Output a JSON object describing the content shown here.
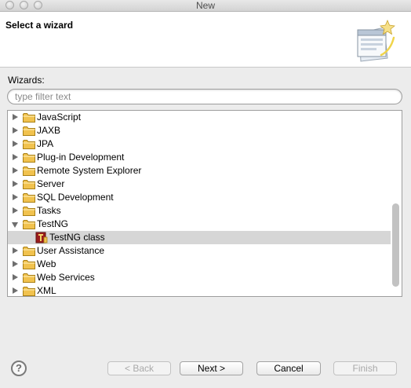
{
  "window": {
    "title": "New"
  },
  "banner": {
    "title": "Select a wizard"
  },
  "wizards_label": "Wizards:",
  "filter": {
    "placeholder": "type filter text",
    "value": ""
  },
  "tree": {
    "items": [
      {
        "label": "JavaScript",
        "type": "folder",
        "expanded": false
      },
      {
        "label": "JAXB",
        "type": "folder",
        "expanded": false
      },
      {
        "label": "JPA",
        "type": "folder",
        "expanded": false
      },
      {
        "label": "Plug-in Development",
        "type": "folder",
        "expanded": false
      },
      {
        "label": "Remote System Explorer",
        "type": "folder",
        "expanded": false
      },
      {
        "label": "Server",
        "type": "folder",
        "expanded": false
      },
      {
        "label": "SQL Development",
        "type": "folder",
        "expanded": false
      },
      {
        "label": "Tasks",
        "type": "folder",
        "expanded": false
      },
      {
        "label": "TestNG",
        "type": "folder",
        "expanded": true
      },
      {
        "label": "TestNG class",
        "type": "item",
        "selected": true
      },
      {
        "label": "User Assistance",
        "type": "folder",
        "expanded": false
      },
      {
        "label": "Web",
        "type": "folder",
        "expanded": false
      },
      {
        "label": "Web Services",
        "type": "folder",
        "expanded": false
      },
      {
        "label": "XML",
        "type": "folder",
        "expanded": false
      }
    ],
    "scroll_position": 0.62
  },
  "buttons": {
    "back": "< Back",
    "next": "Next >",
    "cancel": "Cancel",
    "finish": "Finish"
  },
  "help": {
    "glyph": "?"
  },
  "colors": {
    "selection": "#d6d6d6",
    "folder": "#f1c24e"
  }
}
